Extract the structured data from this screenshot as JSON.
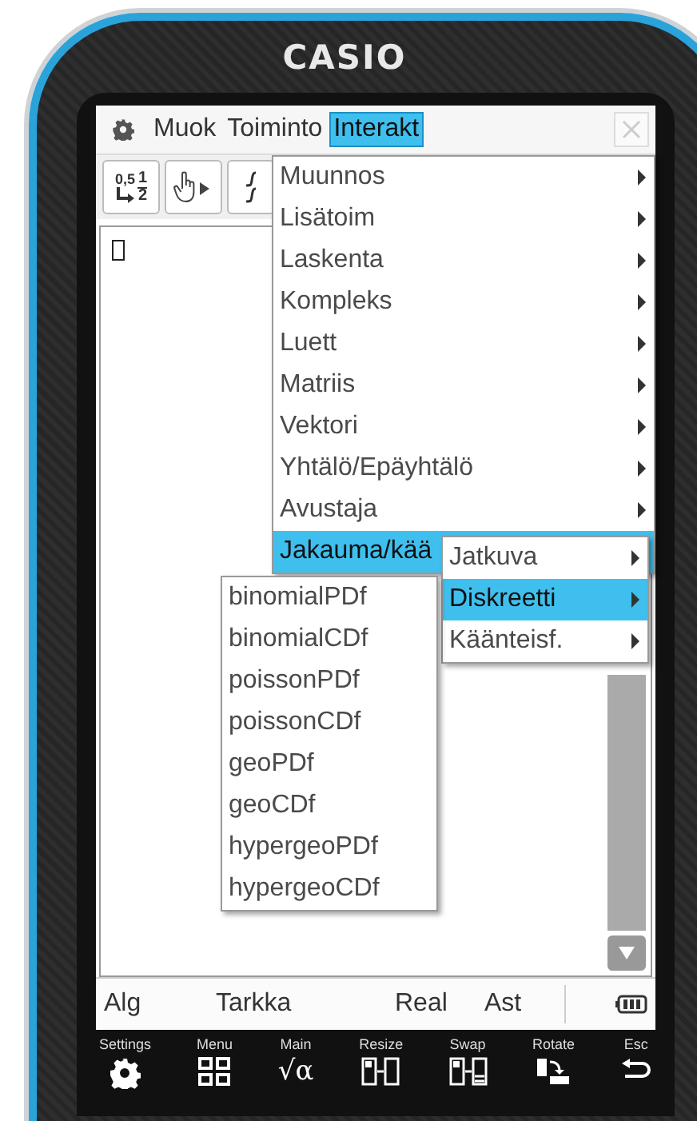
{
  "device": {
    "brand": "CASIO"
  },
  "menubar": {
    "items": [
      {
        "label": "Muok",
        "selected": false
      },
      {
        "label": "Toiminto",
        "selected": false
      },
      {
        "label": "Interakt",
        "selected": true
      }
    ]
  },
  "toolbar": {
    "fraction_button": {
      "decimal": "0,5",
      "numerator": "1",
      "denominator": "2"
    }
  },
  "menu": {
    "items": [
      {
        "label": "Muunnos",
        "selected": false,
        "submenu": true
      },
      {
        "label": "Lisätoim",
        "selected": false,
        "submenu": true
      },
      {
        "label": "Laskenta",
        "selected": false,
        "submenu": true
      },
      {
        "label": "Kompleks",
        "selected": false,
        "submenu": true
      },
      {
        "label": "Luett",
        "selected": false,
        "submenu": true
      },
      {
        "label": "Matriis",
        "selected": false,
        "submenu": true
      },
      {
        "label": "Vektori",
        "selected": false,
        "submenu": true
      },
      {
        "label": "Yhtälö/Epäyhtälö",
        "selected": false,
        "submenu": true
      },
      {
        "label": "Avustaja",
        "selected": false,
        "submenu": true
      },
      {
        "label": "Jakauma/kää",
        "selected": true,
        "submenu": false
      }
    ]
  },
  "submenu": {
    "items": [
      {
        "label": "Jatkuva",
        "selected": false,
        "submenu": true
      },
      {
        "label": "Diskreetti",
        "selected": true,
        "submenu": true
      },
      {
        "label": "Käänteisf.",
        "selected": false,
        "submenu": true
      }
    ]
  },
  "submenu2": {
    "items": [
      {
        "label": "binomialPDf",
        "selected": false
      },
      {
        "label": "binomialCDf",
        "selected": false
      },
      {
        "label": "poissonPDf",
        "selected": false
      },
      {
        "label": "poissonCDf",
        "selected": false
      },
      {
        "label": "geoPDf",
        "selected": false
      },
      {
        "label": "geoCDf",
        "selected": false
      },
      {
        "label": "hypergeoPDf",
        "selected": false
      },
      {
        "label": "hypergeoCDf",
        "selected": false
      }
    ]
  },
  "status_bar": {
    "items": [
      "Alg",
      "Tarkka",
      "Real",
      "Ast"
    ]
  },
  "soft_keys": [
    {
      "label": "Settings",
      "kind": "gear"
    },
    {
      "label": "Menu",
      "kind": "grid"
    },
    {
      "label": "Main",
      "kind": "glyph",
      "glyph": "√α"
    },
    {
      "label": "Resize",
      "kind": "resize"
    },
    {
      "label": "Swap",
      "kind": "swap"
    },
    {
      "label": "Rotate",
      "kind": "rotate"
    },
    {
      "label": "Esc",
      "kind": "back"
    }
  ]
}
